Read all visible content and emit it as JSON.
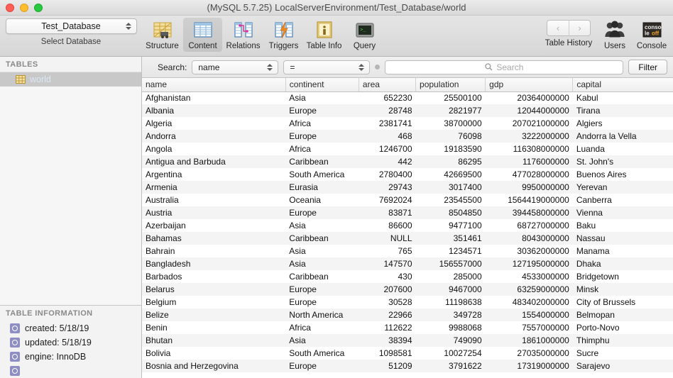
{
  "window": {
    "title": "(MySQL 5.7.25) LocalServerEnvironment/Test_Database/world",
    "close_label": "",
    "minimize_label": "",
    "zoom_label": ""
  },
  "toolbar": {
    "database_select": {
      "value": "Test_Database",
      "caption": "Select Database"
    },
    "items": [
      {
        "icon": "structure-icon",
        "label": "Structure",
        "selected": false
      },
      {
        "icon": "content-icon",
        "label": "Content",
        "selected": true
      },
      {
        "icon": "relations-icon",
        "label": "Relations",
        "selected": false
      },
      {
        "icon": "triggers-icon",
        "label": "Triggers",
        "selected": false
      },
      {
        "icon": "table-info-icon",
        "label": "Table Info",
        "selected": false
      },
      {
        "icon": "query-icon",
        "label": "Query",
        "selected": false
      }
    ],
    "history": {
      "back_glyph": "‹",
      "forward_glyph": "›",
      "label": "Table History"
    },
    "users": {
      "icon": "users-icon",
      "label": "Users"
    },
    "console": {
      "icon": "console-icon",
      "label": "Console",
      "badge_top": "conso",
      "badge_bottom_left": "le",
      "badge_bottom_right": "off"
    }
  },
  "sidebar": {
    "tables_header": "TABLES",
    "tables": [
      {
        "name": "world",
        "icon": "table-icon",
        "selected": true
      }
    ],
    "info_header": "TABLE INFORMATION",
    "info_items": [
      {
        "label": "created: 5/18/19"
      },
      {
        "label": "updated: 5/18/19"
      },
      {
        "label": "engine: InnoDB"
      }
    ]
  },
  "search": {
    "label": "Search:",
    "field_select": "name",
    "operator_select": "=",
    "placeholder": "Search",
    "value": "",
    "filter_label": "Filter"
  },
  "grid": {
    "columns": [
      "name",
      "continent",
      "area",
      "population",
      "gdp",
      "capital"
    ],
    "rows": [
      [
        "Afghanistan",
        "Asia",
        "652230",
        "25500100",
        "20364000000",
        "Kabul"
      ],
      [
        "Albania",
        "Europe",
        "28748",
        "2821977",
        "12044000000",
        "Tirana"
      ],
      [
        "Algeria",
        "Africa",
        "2381741",
        "38700000",
        "207021000000",
        "Algiers"
      ],
      [
        "Andorra",
        "Europe",
        "468",
        "76098",
        "3222000000",
        "Andorra la Vella"
      ],
      [
        "Angola",
        "Africa",
        "1246700",
        "19183590",
        "116308000000",
        "Luanda"
      ],
      [
        "Antigua and Barbuda",
        "Caribbean",
        "442",
        "86295",
        "1176000000",
        "St. John's"
      ],
      [
        "Argentina",
        "South America",
        "2780400",
        "42669500",
        "477028000000",
        "Buenos Aires"
      ],
      [
        "Armenia",
        "Eurasia",
        "29743",
        "3017400",
        "9950000000",
        "Yerevan"
      ],
      [
        "Australia",
        "Oceania",
        "7692024",
        "23545500",
        "1564419000000",
        "Canberra"
      ],
      [
        "Austria",
        "Europe",
        "83871",
        "8504850",
        "394458000000",
        "Vienna"
      ],
      [
        "Azerbaijan",
        "Asia",
        "86600",
        "9477100",
        "68727000000",
        "Baku"
      ],
      [
        "Bahamas",
        "Caribbean",
        "NULL",
        "351461",
        "8043000000",
        "Nassau"
      ],
      [
        "Bahrain",
        "Asia",
        "765",
        "1234571",
        "30362000000",
        "Manama"
      ],
      [
        "Bangladesh",
        "Asia",
        "147570",
        "156557000",
        "127195000000",
        "Dhaka"
      ],
      [
        "Barbados",
        "Caribbean",
        "430",
        "285000",
        "4533000000",
        "Bridgetown"
      ],
      [
        "Belarus",
        "Europe",
        "207600",
        "9467000",
        "63259000000",
        "Minsk"
      ],
      [
        "Belgium",
        "Europe",
        "30528",
        "11198638",
        "483402000000",
        "City of Brussels"
      ],
      [
        "Belize",
        "North America",
        "22966",
        "349728",
        "1554000000",
        "Belmopan"
      ],
      [
        "Benin",
        "Africa",
        "112622",
        "9988068",
        "7557000000",
        "Porto-Novo"
      ],
      [
        "Bhutan",
        "Asia",
        "38394",
        "749090",
        "1861000000",
        "Thimphu"
      ],
      [
        "Bolivia",
        "South America",
        "1098581",
        "10027254",
        "27035000000",
        "Sucre"
      ],
      [
        "Bosnia and Herzegovina",
        "Europe",
        "51209",
        "3791622",
        "17319000000",
        "Sarajevo"
      ]
    ],
    "null_token": "NULL",
    "numeric_columns": [
      2,
      3,
      4
    ]
  },
  "colors": {
    "selection": "#c8c8c8",
    "selected_text": "#dce7f5",
    "null_text": "#a9a9a9",
    "toolbar_bg": "#e0e0e0",
    "row_alt": "#f4f4f4"
  }
}
